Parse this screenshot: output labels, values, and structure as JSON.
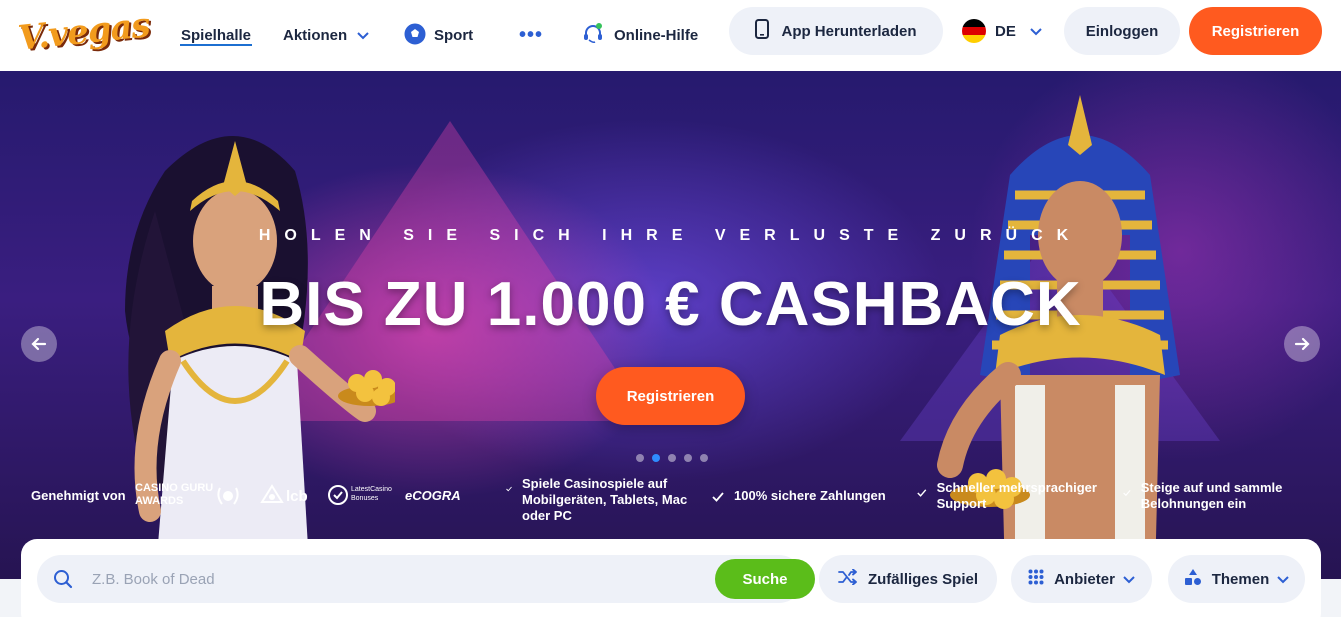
{
  "header": {
    "logo_text": "V.vegas",
    "nav": {
      "spielhalle": "Spielhalle",
      "aktionen": "Aktionen",
      "sport": "Sport",
      "more": "•••",
      "help": "Online-Hilfe"
    },
    "app_button": "App Herunterladen",
    "language": "DE",
    "login": "Einloggen",
    "register": "Registrieren"
  },
  "hero": {
    "subtitle": "HOLEN SIE SICH IHRE VERLUSTE ZURÜCK",
    "title": "BIS ZU 1.000 € CASHBACK",
    "cta": "Registrieren",
    "slides_total": 5,
    "active_slide": 2
  },
  "trust": {
    "approved_by": "Genehmigt von",
    "casino_guru_line1": "CASINO GURU",
    "casino_guru_line2": "AWARDS",
    "lcb": "lcb",
    "latestcasino_line1": "LatestCasino",
    "latestcasino_line2": "Bonuses",
    "cogra": "eCOGRA",
    "features": [
      "Spiele Casinospiele auf Mobilgeräten, Tablets, Mac oder PC",
      "100% sichere Zahlungen",
      "Schneller mehrsprachiger Support",
      "Steige auf und sammle Belohnungen ein"
    ]
  },
  "search": {
    "placeholder": "Z.B. Book of Dead",
    "button": "Suche",
    "random_game": "Zufälliges Spiel",
    "providers": "Anbieter",
    "themes": "Themen"
  },
  "colors": {
    "accent_orange": "#ff5a1f",
    "search_green": "#5bbd1a",
    "nav_blue": "#1c6fd1",
    "text_dark": "#1c2740"
  }
}
